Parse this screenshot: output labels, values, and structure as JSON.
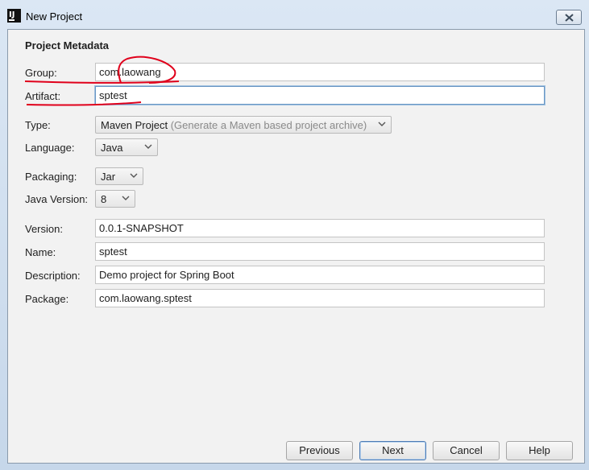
{
  "window": {
    "title": "New Project",
    "app_icon_text": "IJ"
  },
  "section": {
    "title": "Project Metadata"
  },
  "fields": {
    "group": {
      "label": "Group:",
      "value": "com.laowang"
    },
    "artifact": {
      "label": "Artifact:",
      "value": "sptest"
    },
    "type": {
      "label": "Type:",
      "value": "Maven Project",
      "hint": "(Generate a Maven based project archive)"
    },
    "language": {
      "label": "Language:",
      "value": "Java"
    },
    "packaging": {
      "label": "Packaging:",
      "value": "Jar"
    },
    "java_version": {
      "label": "Java Version:",
      "value": "8"
    },
    "version": {
      "label": "Version:",
      "value": "0.0.1-SNAPSHOT"
    },
    "name": {
      "label": "Name:",
      "value": "sptest"
    },
    "description": {
      "label": "Description:",
      "value": "Demo project for Spring Boot"
    },
    "package": {
      "label": "Package:",
      "value": "com.laowang.sptest"
    }
  },
  "buttons": {
    "previous": "Previous",
    "next": "Next",
    "cancel": "Cancel",
    "help": "Help"
  },
  "colors": {
    "annotation": "#e0001b",
    "focus": "#6a97c4"
  }
}
